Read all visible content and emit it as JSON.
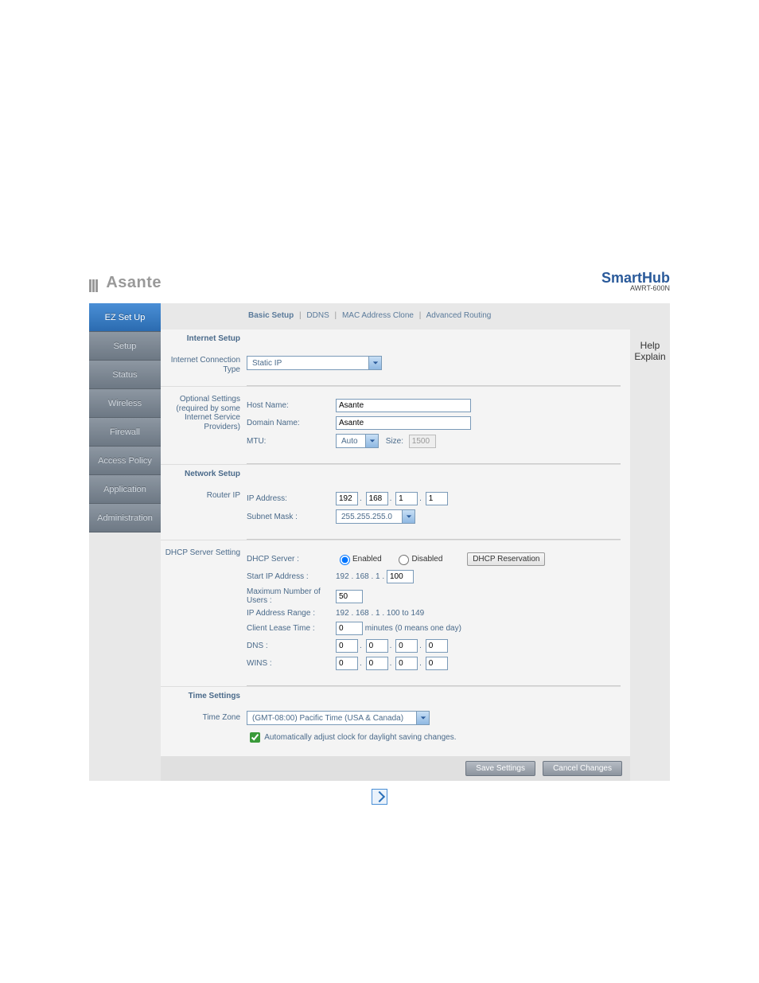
{
  "brand": {
    "left": "Asante",
    "right_title": "SmartHub",
    "right_model": "AWRT-600N"
  },
  "sidebar": {
    "items": [
      {
        "label": "EZ Set Up",
        "active": true
      },
      {
        "label": "Setup"
      },
      {
        "label": "Status"
      },
      {
        "label": "Wireless"
      },
      {
        "label": "Firewall"
      },
      {
        "label": "Access Policy"
      },
      {
        "label": "Application"
      },
      {
        "label": "Administration"
      }
    ]
  },
  "tabs": {
    "items": [
      "Basic Setup",
      "DDNS",
      "MAC Address Clone",
      "Advanced Routing"
    ],
    "active_index": 0
  },
  "help": {
    "line1": "Help",
    "line2": "Explain"
  },
  "internet_setup": {
    "heading": "Internet Setup",
    "conn_type_label": "Internet Connection Type",
    "conn_type_value": "Static IP",
    "optional_heading": "Optional Settings (required by some Internet Service Providers)",
    "host_name_label": "Host Name:",
    "host_name_value": "Asante",
    "domain_name_label": "Domain Name:",
    "domain_name_value": "Asante",
    "mtu_label": "MTU:",
    "mtu_mode": "Auto",
    "mtu_size_label": "Size:",
    "mtu_size_value": "1500"
  },
  "network_setup": {
    "heading": "Network Setup",
    "router_ip_label": "Router IP",
    "ip_label": "IP Address:",
    "ip": [
      "192",
      "168",
      "1",
      "1"
    ],
    "mask_label": "Subnet Mask :",
    "mask_value": "255.255.255.0"
  },
  "dhcp": {
    "heading": "DHCP Server Setting",
    "server_label": "DHCP Server :",
    "enabled_label": "Enabled",
    "disabled_label": "Disabled",
    "reservation_label": "DHCP Reservation",
    "start_ip_label": "Start IP Address :",
    "start_ip_prefix": "192 . 168 . 1 .",
    "start_ip_value": "100",
    "max_users_label": "Maximum Number of Users :",
    "max_users_value": "50",
    "range_label": "IP Address Range :",
    "range_value": "192 . 168 . 1 . 100 to 149",
    "lease_label": "Client Lease Time :",
    "lease_value": "0",
    "lease_suffix": "minutes (0 means one day)",
    "dns_label": "DNS :",
    "dns": [
      "0",
      "0",
      "0",
      "0"
    ],
    "wins_label": "WINS :",
    "wins": [
      "0",
      "0",
      "0",
      "0"
    ]
  },
  "time": {
    "heading": "Time Settings",
    "tz_label": "Time Zone",
    "tz_value": "(GMT-08:00) Pacific Time (USA & Canada)",
    "auto_dst_label": "Automatically adjust clock for daylight saving changes."
  },
  "buttons": {
    "save": "Save Settings",
    "cancel": "Cancel Changes"
  }
}
